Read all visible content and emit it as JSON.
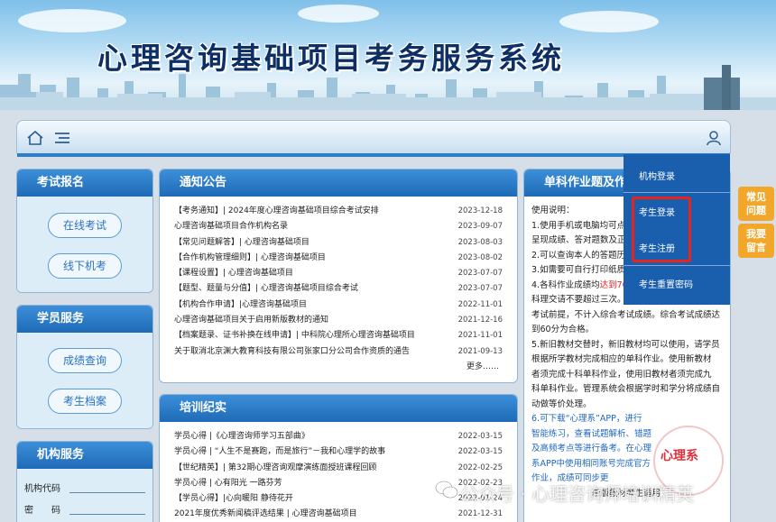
{
  "banner": {
    "title": "心理咨询基础项目考务服务系统"
  },
  "nav": {
    "home_icon": "home-icon",
    "menu_icon": "menu-icon",
    "user_icon": "user-icon"
  },
  "exam": {
    "title": "考试报名",
    "online": "在线考试",
    "offline": "线下机考"
  },
  "student": {
    "title": "学员服务",
    "score": "成绩查询",
    "archive": "考生档案"
  },
  "org": {
    "title": "机构服务",
    "code_label": "机构代码",
    "pwd_label": "密　　码"
  },
  "notice": {
    "title": "通知公告",
    "items": [
      {
        "text": "【考务通知】| 2024年度心理咨询基础项目综合考试安排",
        "date": "2023-12-18"
      },
      {
        "text": "心理咨询基础项目合作机构名录",
        "date": "2023-09-07"
      },
      {
        "text": "【常见问题解答】| 心理咨询基础项目",
        "date": "2023-08-03"
      },
      {
        "text": "【合作机构管理细则】| 心理咨询基础项目",
        "date": "2023-08-02"
      },
      {
        "text": "【课程设置】| 心理咨询基础项目",
        "date": "2023-07-07"
      },
      {
        "text": "【题型、题量与分值】| 心理咨询基础项目综合考试",
        "date": "2023-07-07"
      },
      {
        "text": "【机构合作申请】|心理咨询基础项目",
        "date": "2022-11-01"
      },
      {
        "text": "心理咨询基础项目关于启用新版教材的通知",
        "date": "2021-12-16"
      },
      {
        "text": "【档案题录、证书补换在线申请】| 中科院心理所心理咨询基础项目",
        "date": "2021-11-01"
      },
      {
        "text": "关于取消北京渊大教育科技有限公司张家口分公司合作资质的通告",
        "date": "2021-09-13"
      }
    ],
    "more": "更多……"
  },
  "training": {
    "title": "培训纪实",
    "items": [
      {
        "text": "学员心得 |《心理咨询师学习五部曲》",
        "date": "2022-03-15"
      },
      {
        "text": "学员心得 | “人生不是赛跑，而是旅行”－我和心理学的故事",
        "date": "2022-03-15"
      },
      {
        "text": "【世纪精英】| 第32期心理咨询观摩演练面授班课程回顾",
        "date": "2022-02-25"
      },
      {
        "text": "学员心得 | 心有阳光 一路芬芳",
        "date": "2022-02-23"
      },
      {
        "text": "【学员心得】|心向暖阳 静待花开",
        "date": "2022-01-24"
      },
      {
        "text": "2021年度优秀新闻稿评选结果 | 心理咨询基础项目",
        "date": "2021-12-31"
      }
    ]
  },
  "single": {
    "title": "单科作业题及作",
    "lines": [
      "使用说明：",
      "1.使用手机或电脑均可点",
      "呈现成绩、答对题数及正",
      "2.可以查询本人的答题历",
      "3.如需要可自行打印纸质",
      "4.各科作业成绩均",
      "科理交请不要超过三次。",
      "考试前提，不计入综合考试成绩。综合考试成绩达",
      "到60分为合格。",
      "5.新旧教材交替时，新旧教材均可以使用，请学员",
      "根据所学教材完成相应的单科作业。使用新教材",
      "者须完成十科单科作业，使用旧教材者须完成九",
      "科单科作业。管理系统会根据学时和学分将成绩自",
      "动做等价处理。",
      "6.可下载“心理系”APP，进行",
      "智能练习，查看试题解析、错题",
      "及高频考点等进行备考。在心理",
      "系APP中使用相同账号完成官方",
      "作业，成绩可同步更"
    ],
    "red_fragment": "达到70",
    "red_account": "相同账号",
    "footer": "新版教材考生适用"
  },
  "dropdown": {
    "org_login": "机构登录",
    "student_login": "考生登录",
    "student_register": "考生注册",
    "reset_password": "考生重置密码"
  },
  "float": {
    "faq": "常见问题",
    "message": "我要留言"
  },
  "watermark": {
    "text": "公众号 · 心理咨询师培训精英",
    "logo": "心理系"
  },
  "colors": {
    "accent": "#1f6ab8",
    "dropdown": "#1a5fae",
    "highlight": "#e8241c",
    "float": "#f2a62a"
  }
}
